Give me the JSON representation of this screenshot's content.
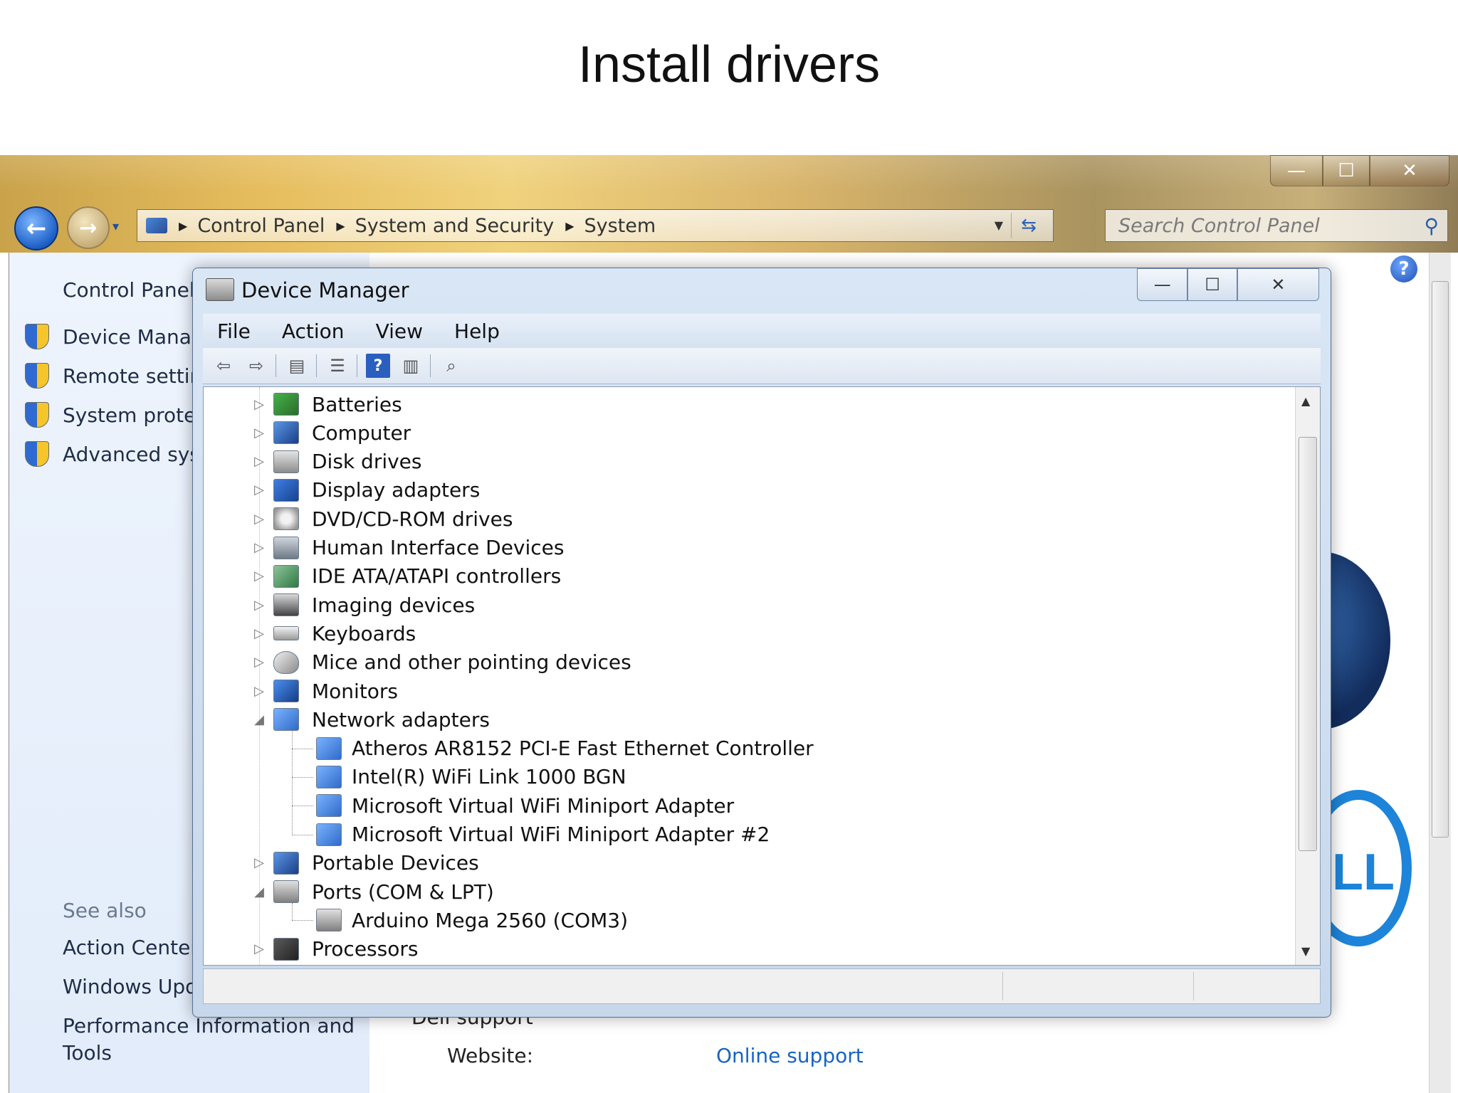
{
  "slide": {
    "title": "Install drivers"
  },
  "control_panel": {
    "window_controls": {
      "minimize": "—",
      "maximize": "☐",
      "close": "✕"
    },
    "nav": {
      "back": "←",
      "forward": "→",
      "dropdown": "▾"
    },
    "breadcrumbs": [
      "Control Panel",
      "System and Security",
      "System"
    ],
    "search_placeholder": "Search Control Panel",
    "left_pane": {
      "home_link": "Control Panel",
      "tasks": [
        "Device Manag",
        "Remote settin",
        "System prote",
        "Advanced sys"
      ],
      "see_also_label": "See also",
      "see_also_links": [
        "Action Center",
        "Windows Upd",
        "Performance Information and Tools"
      ]
    },
    "main": {
      "dell_support_heading": "Dell support",
      "website_label": "Website:",
      "website_link": "Online support",
      "dell_logo": "LL"
    },
    "help": "?"
  },
  "device_manager": {
    "title": "Device Manager",
    "window_controls": {
      "minimize": "—",
      "maximize": "☐",
      "close": "✕"
    },
    "menu": [
      "File",
      "Action",
      "View",
      "Help"
    ],
    "toolbar_help": "?",
    "tree": [
      {
        "label": "Batteries",
        "expanded": false,
        "icon": "battery-icon",
        "children": []
      },
      {
        "label": "Computer",
        "expanded": false,
        "icon": "computer-icon",
        "children": []
      },
      {
        "label": "Disk drives",
        "expanded": false,
        "icon": "disk-drive-icon",
        "children": []
      },
      {
        "label": "Display adapters",
        "expanded": false,
        "icon": "display-adapter-icon",
        "children": []
      },
      {
        "label": "DVD/CD-ROM drives",
        "expanded": false,
        "icon": "dvd-drive-icon",
        "children": []
      },
      {
        "label": "Human Interface Devices",
        "expanded": false,
        "icon": "hid-icon",
        "children": []
      },
      {
        "label": "IDE ATA/ATAPI controllers",
        "expanded": false,
        "icon": "ide-controller-icon",
        "children": []
      },
      {
        "label": "Imaging devices",
        "expanded": false,
        "icon": "imaging-device-icon",
        "children": []
      },
      {
        "label": "Keyboards",
        "expanded": false,
        "icon": "keyboard-icon",
        "children": []
      },
      {
        "label": "Mice and other pointing devices",
        "expanded": false,
        "icon": "mouse-icon",
        "children": []
      },
      {
        "label": "Monitors",
        "expanded": false,
        "icon": "monitor-icon",
        "children": []
      },
      {
        "label": "Network adapters",
        "expanded": true,
        "icon": "network-adapter-icon",
        "children": [
          "Atheros AR8152 PCI-E Fast Ethernet Controller",
          "Intel(R) WiFi Link 1000 BGN",
          "Microsoft Virtual WiFi Miniport Adapter",
          "Microsoft Virtual WiFi Miniport Adapter #2"
        ]
      },
      {
        "label": "Portable Devices",
        "expanded": false,
        "icon": "portable-device-icon",
        "children": []
      },
      {
        "label": "Ports (COM & LPT)",
        "expanded": true,
        "icon": "port-icon",
        "children": [
          "Arduino Mega 2560 (COM3)"
        ]
      },
      {
        "label": "Processors",
        "expanded": false,
        "icon": "processor-icon",
        "children": []
      }
    ]
  }
}
